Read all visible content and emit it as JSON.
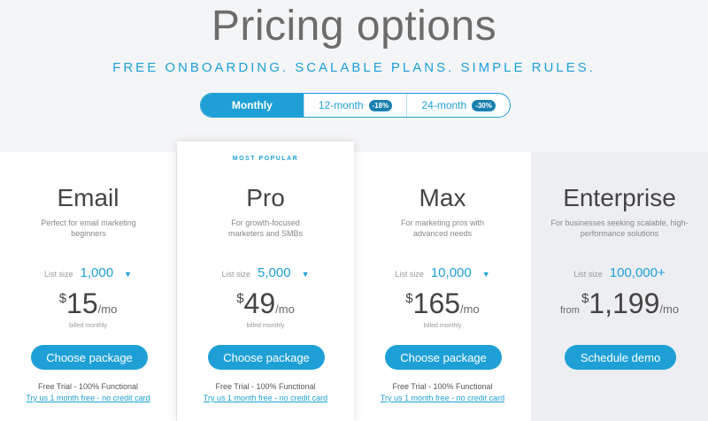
{
  "header": {
    "title": "Pricing options",
    "tagline": "FREE ONBOARDING. SCALABLE PLANS. SIMPLE RULES."
  },
  "billing_toggle": {
    "options": [
      {
        "label": "Monthly",
        "badge": "",
        "active": true
      },
      {
        "label": "12-month",
        "badge": "-18%",
        "active": false
      },
      {
        "label": "24-month",
        "badge": "-30%",
        "active": false
      }
    ]
  },
  "plans": [
    {
      "name": "Email",
      "description": "Perfect for email marketing beginners",
      "list_size_label": "List size",
      "list_size": "1,000",
      "currency": "$",
      "price": "15",
      "period": "/mo",
      "billed": "billed monthly",
      "cta": "Choose package",
      "trial": "Free Trial - 100% Functional",
      "trial_link": "Try us 1 month free - no credit card"
    },
    {
      "badge": "MOST POPULAR",
      "name": "Pro",
      "description": "For growth-focused marketers and SMBs",
      "list_size_label": "List size",
      "list_size": "5,000",
      "currency": "$",
      "price": "49",
      "period": "/mo",
      "billed": "billed monthly",
      "cta": "Choose package",
      "trial": "Free Trial - 100% Functional",
      "trial_link": "Try us 1 month free - no credit card"
    },
    {
      "name": "Max",
      "description": "For marketing pros with advanced needs",
      "list_size_label": "List size",
      "list_size": "10,000",
      "currency": "$",
      "price": "165",
      "period": "/mo",
      "billed": "billed monthly",
      "cta": "Choose package",
      "trial": "Free Trial - 100% Functional",
      "trial_link": "Try us 1 month free - no credit card"
    },
    {
      "name": "Enterprise",
      "description": "For businesses seeking scalable, high-performance solutions",
      "list_size_label": "List size",
      "list_size": "100,000+",
      "from": "from",
      "currency": "$",
      "price": "1,199",
      "period": "/mo",
      "cta": "Schedule demo"
    }
  ],
  "icons": {
    "dropdown": "chevron-down-icon"
  },
  "colors": {
    "accent": "#1ea0d6",
    "enterprise_bg": "#eceef2",
    "page_bg": "#f4f5f7"
  }
}
